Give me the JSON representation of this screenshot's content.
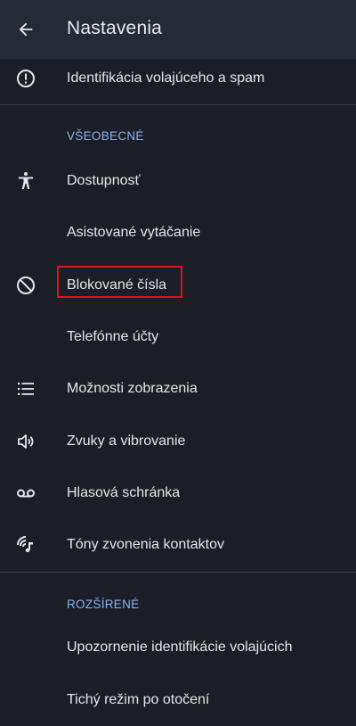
{
  "appbar": {
    "title": "Nastavenia"
  },
  "top_item": {
    "label": "Identifikácia volajúceho a spam",
    "icon": "alert-circle-icon"
  },
  "sections": {
    "general_header": "VŠEOBECNÉ",
    "advanced_header": "ROZŠÍRENÉ"
  },
  "general_items": [
    {
      "label": "Dostupnosť",
      "icon": "accessibility-icon"
    },
    {
      "label": "Asistované vytáčanie",
      "icon": ""
    },
    {
      "label": "Blokované čísla",
      "icon": "block-icon"
    },
    {
      "label": "Telefónne účty",
      "icon": ""
    },
    {
      "label": "Možnosti zobrazenia",
      "icon": "list-icon"
    },
    {
      "label": "Zvuky a vibrovanie",
      "icon": "volume-icon"
    },
    {
      "label": "Hlasová schránka",
      "icon": "voicemail-icon"
    },
    {
      "label": "Tóny zvonenia kontaktov",
      "icon": "ringtone-icon"
    }
  ],
  "advanced_items": [
    {
      "label": "Upozornenie identifikácie volajúcich"
    },
    {
      "label": "Tichý režim po otočení"
    }
  ],
  "colors": {
    "background": "#1b1e26",
    "appbar": "#252a35",
    "accent": "#8ab4f8",
    "highlight": "#e0121b"
  }
}
